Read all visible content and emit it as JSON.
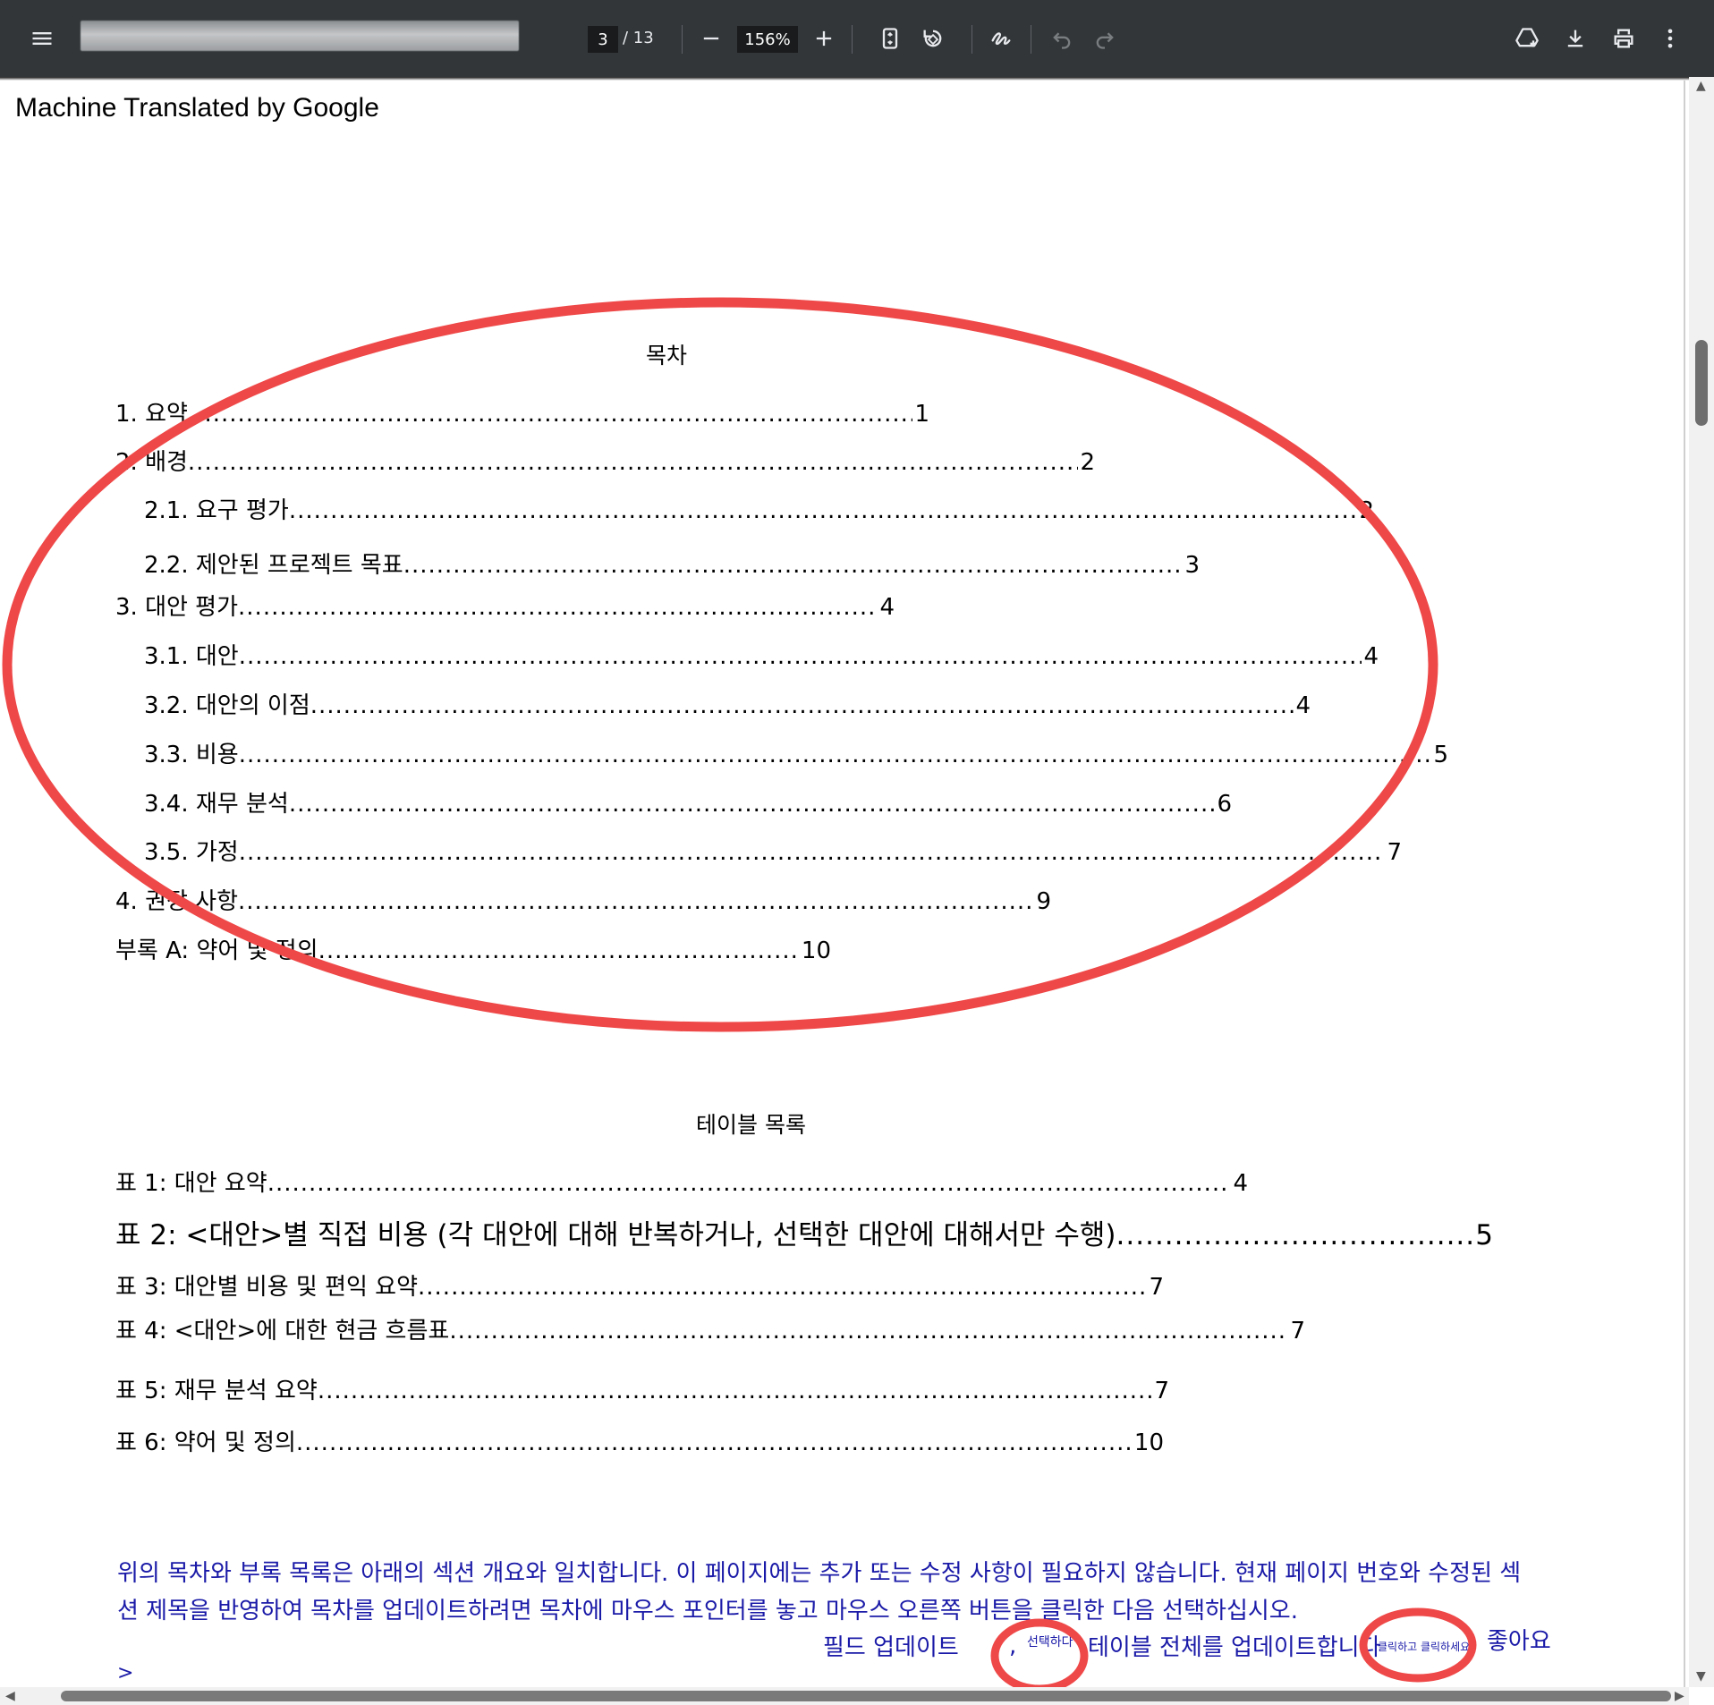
{
  "toolbar": {
    "page_current": "3",
    "page_total": "/ 13",
    "zoom": "156%",
    "icons": {
      "menu": "menu-icon",
      "zoom_out": "minus-icon",
      "zoom_in": "plus-icon",
      "fit": "fit-page-icon",
      "rotate": "rotate-icon",
      "annotate": "pen-icon",
      "undo": "undo-icon",
      "redo": "redo-icon",
      "drive": "add-to-drive-icon",
      "download": "download-icon",
      "print": "print-icon",
      "more": "more-vert-icon"
    }
  },
  "document": {
    "translation_label": "Machine Translated by Google",
    "toc": {
      "title": "목차",
      "entries": [
        {
          "label": "1. 요약",
          "page": "1"
        },
        {
          "label": "2.          배경",
          "page": "2"
        },
        {
          "label": "2.1. 요구 평가",
          "page": "2"
        },
        {
          "label": "2.2. 제안된 프로젝트 목표",
          "page": "3"
        },
        {
          "label": "3. 대안 평가 ",
          "page": "4"
        },
        {
          "label": "3.1. 대안 ",
          "page": "4"
        },
        {
          "label": "3.2. 대안의 이점",
          "page": "4"
        },
        {
          "label": "3.3. 비용",
          "page": "5"
        },
        {
          "label": "3.4. 재무 분석 ",
          "page": "6"
        },
        {
          "label": "3.5. 가정 ",
          "page": "7"
        },
        {
          "label": "4.        권장 사항",
          "page": "9"
        },
        {
          "label": "부록 A: 약어 및 정의",
          "page": "10"
        }
      ]
    },
    "tables": {
      "title": "테이블 목록",
      "entries": [
        {
          "label": "표 1: 대안 요약",
          "page": "4"
        },
        {
          "label": "표 2: <대안>별 직접 비용 (각 대안에 대해 반복하거나, 선택한 대안에 대해서만 수행)",
          "page": "5"
        },
        {
          "label": "표 3: 대안별 비용 및 편익 요약 ",
          "page": "7"
        },
        {
          "label": "표 4: <대안>에 대한 현금 흐름표 ",
          "page": "7"
        },
        {
          "label": "표 5: 재무 분석 요약",
          "page": "7"
        },
        {
          "label": "표 6: 약어 및 정의",
          "page": "10"
        }
      ]
    },
    "note": {
      "line1": "위의 목차와 부록 목록은 아래의 섹션 개요와 일치합니다. 이 페이지에는 추가 또는 수정 사항이 필요하지 않습니다. 현재 페이지 번호와 수정된 섹",
      "line2": "션 제목을 반영하여 목차를 업데이트하려면 목차에 마우스 포인터를 놓고 마우스 오른쪽 버튼을 클릭한 다음 선택하십시오.",
      "field_update": "필드 업데이트",
      "comma": ",",
      "select_small": "선택하다",
      "update_table": "테이블 전체를 업데이트합니다",
      "click_small": "클릭하고 클릭하세요",
      "ok": "좋아요",
      "arrow": ">"
    }
  },
  "colors": {
    "toolbar_bg": "#323639",
    "annotation_red": "#ef4848",
    "note_blue": "#1a1aa8"
  }
}
